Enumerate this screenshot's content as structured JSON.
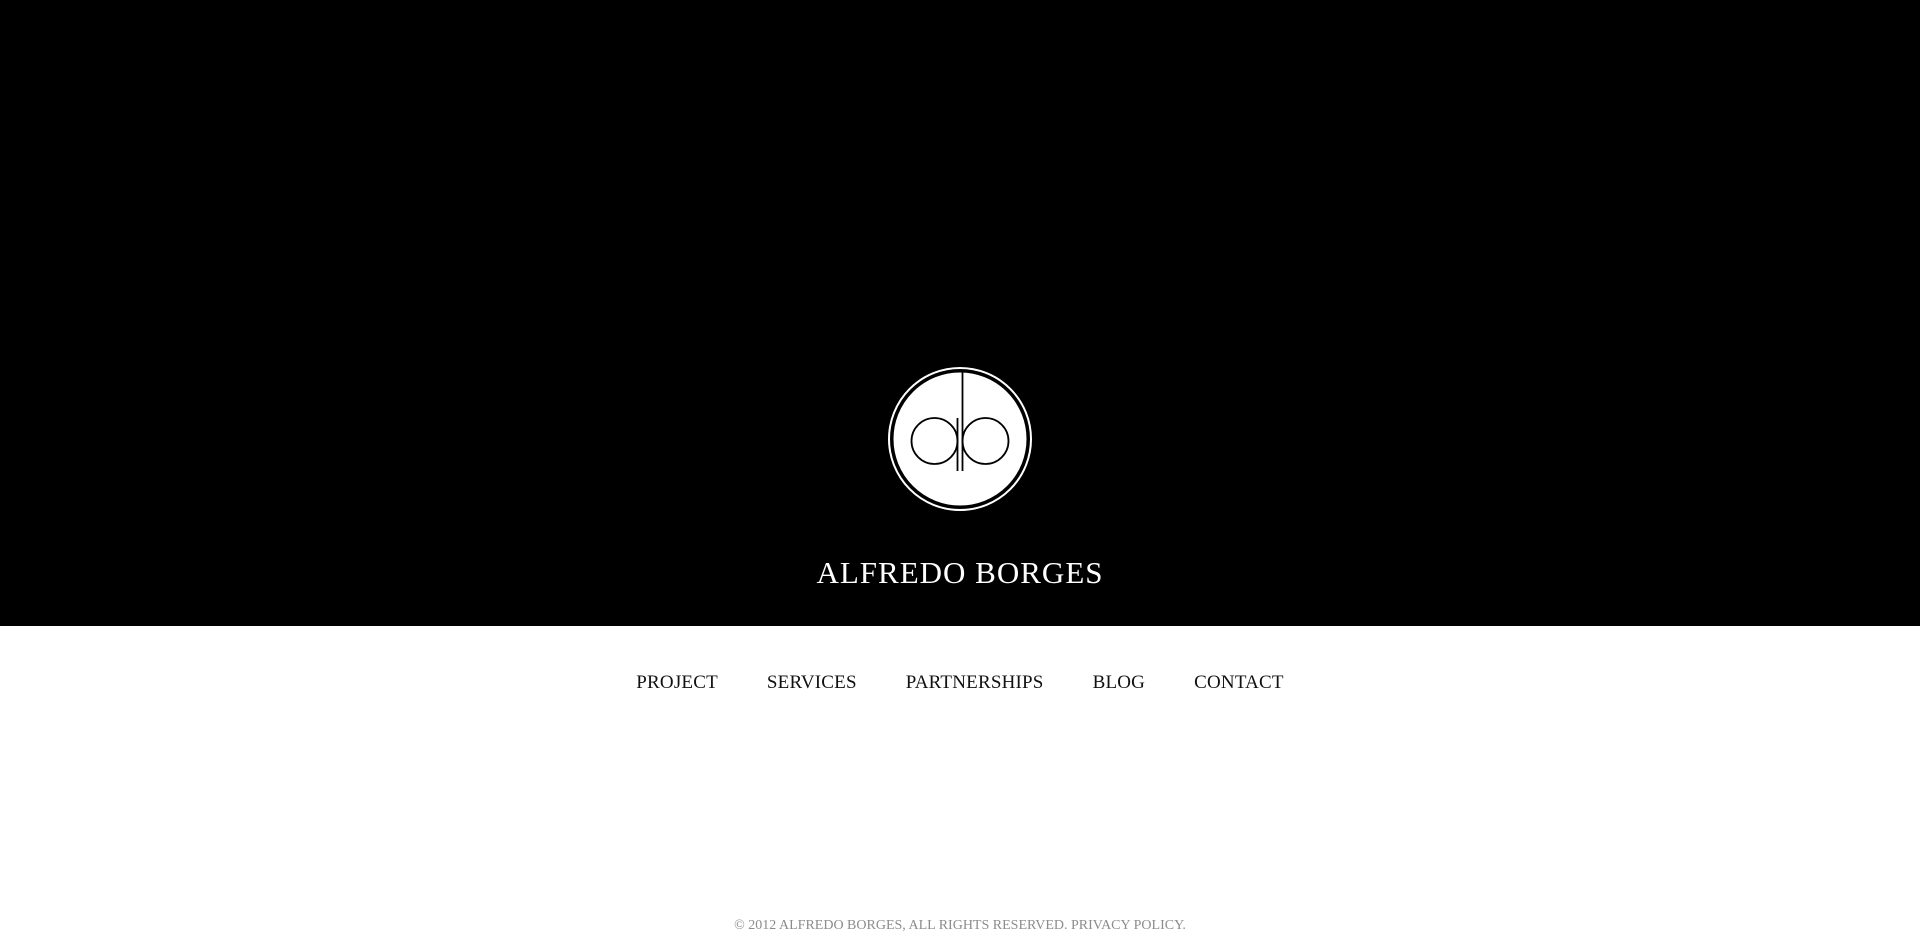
{
  "site": {
    "logo_monogram": "ab",
    "name": "ALFREDO BORGES"
  },
  "nav": {
    "items": [
      {
        "label": "PROJECT"
      },
      {
        "label": "SERVICES"
      },
      {
        "label": "PARTNERSHIPS"
      },
      {
        "label": "BLOG"
      },
      {
        "label": "CONTACT"
      }
    ]
  },
  "footer": {
    "copyright": "© 2012 ALFREDO BORGES, ALL RIGHTS RESERVED.",
    "privacy_label": "PRIVACY POLICY."
  },
  "colors": {
    "hero_background": "#000000",
    "page_background": "#ffffff",
    "nav_text": "#111111",
    "footer_text": "#8c8c8c"
  }
}
